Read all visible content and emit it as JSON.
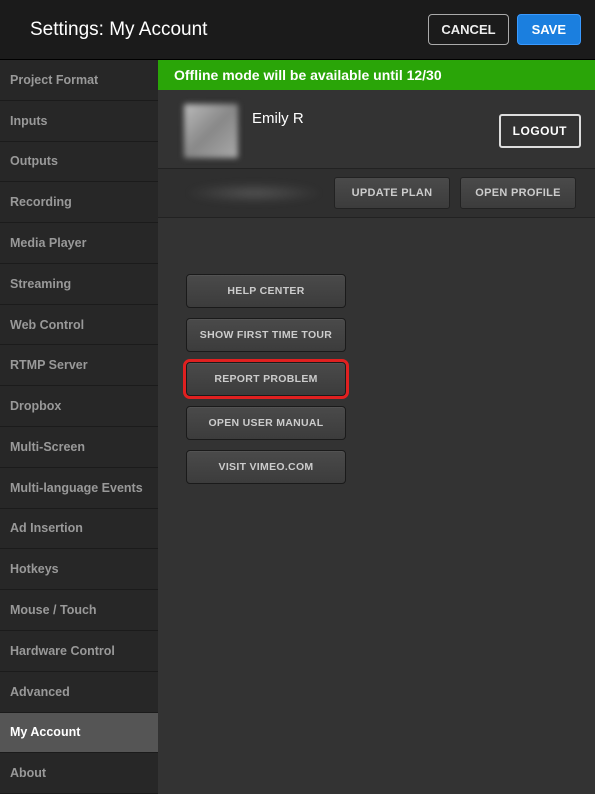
{
  "header": {
    "title": "Settings: My Account",
    "cancel": "CANCEL",
    "save": "SAVE"
  },
  "sidebar": {
    "items": [
      "Project Format",
      "Inputs",
      "Outputs",
      "Recording",
      "Media Player",
      "Streaming",
      "Web Control",
      "RTMP Server",
      "Dropbox",
      "Multi-Screen",
      "Multi-language Events",
      "Ad Insertion",
      "Hotkeys",
      "Mouse / Touch",
      "Hardware Control",
      "Advanced",
      "My Account",
      "About"
    ],
    "activeIndex": 16
  },
  "banner": "Offline mode will be available until 12/30",
  "profile": {
    "name": "Emily R",
    "logout": "LOGOUT"
  },
  "plan": {
    "update": "UPDATE PLAN",
    "open": "OPEN PROFILE"
  },
  "actions": [
    {
      "label": "HELP CENTER",
      "highlighted": false
    },
    {
      "label": "SHOW FIRST TIME TOUR",
      "highlighted": false
    },
    {
      "label": "REPORT PROBLEM",
      "highlighted": true
    },
    {
      "label": "OPEN USER MANUAL",
      "highlighted": false
    },
    {
      "label": "VISIT VIMEO.COM",
      "highlighted": false
    }
  ]
}
